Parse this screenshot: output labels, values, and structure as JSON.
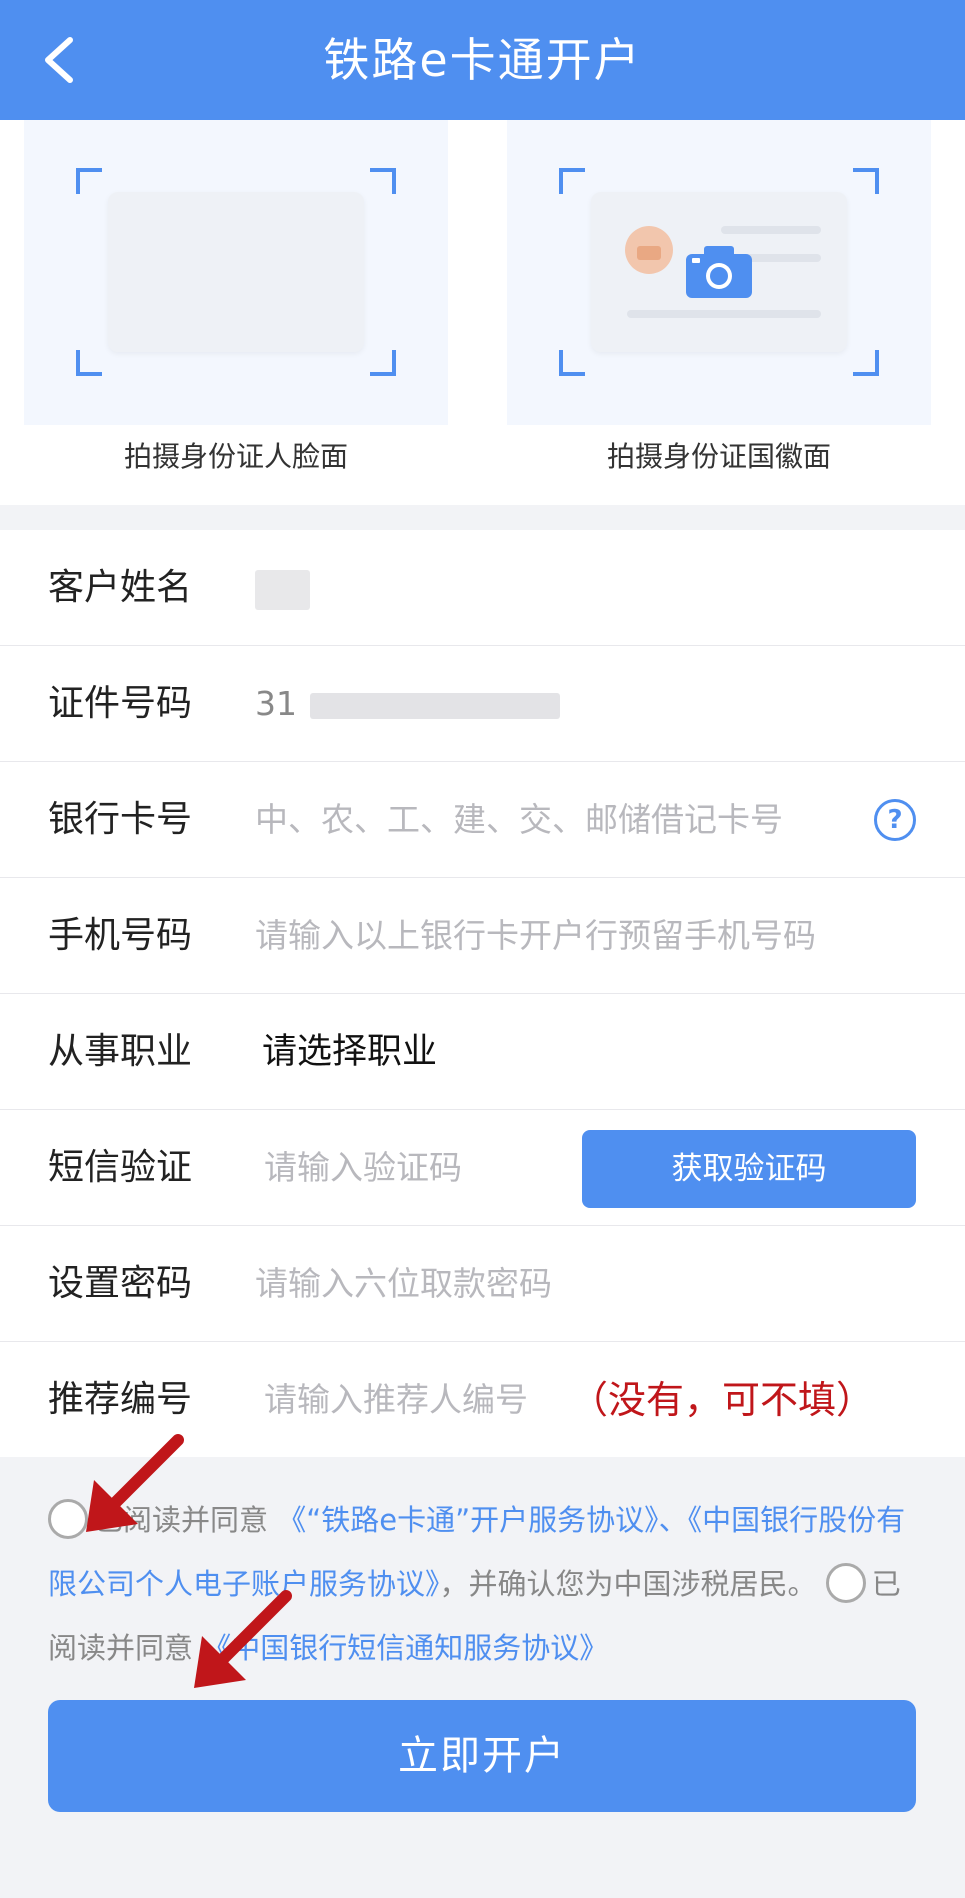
{
  "header": {
    "back_icon": "chevron-left-icon",
    "title": "铁路e卡通开户"
  },
  "photos": {
    "front_label": "拍摄身份证人脸面",
    "back_label": "拍摄身份证国徽面",
    "camera_icon": "camera-icon"
  },
  "form": {
    "name": {
      "label": "客户姓名",
      "value": ""
    },
    "id_number": {
      "label": "证件号码",
      "value": "31"
    },
    "bank_card": {
      "label": "银行卡号",
      "placeholder": "中、农、工、建、交、邮储借记卡号",
      "help": "?"
    },
    "phone": {
      "label": "手机号码",
      "placeholder": "请输入以上银行卡开户行预留手机号码"
    },
    "occupation": {
      "label": "从事职业",
      "value": "请选择职业"
    },
    "sms": {
      "label": "短信验证",
      "placeholder": "请输入验证码",
      "button": "获取验证码"
    },
    "password": {
      "label": "设置密码",
      "placeholder": "请输入六位取款密码"
    },
    "referrer": {
      "label": "推荐编号",
      "placeholder": "请输入推荐人编号",
      "note": "（没有，可不填）"
    }
  },
  "agreement": {
    "text1": "已阅读并同意",
    "link1": "《“铁路e卡通”开户服务协议》、《中国银行股份有限公司个人电子账户服务协议》",
    "text2": "，并确认您为中国涉税居民。",
    "text3": "已阅读并同意",
    "link2": "《中国银行短信通知服务协议》"
  },
  "submit_label": "立即开户",
  "colors": {
    "primary": "#4f8ff0",
    "note": "#c0161a",
    "arrow": "#c0161a"
  }
}
